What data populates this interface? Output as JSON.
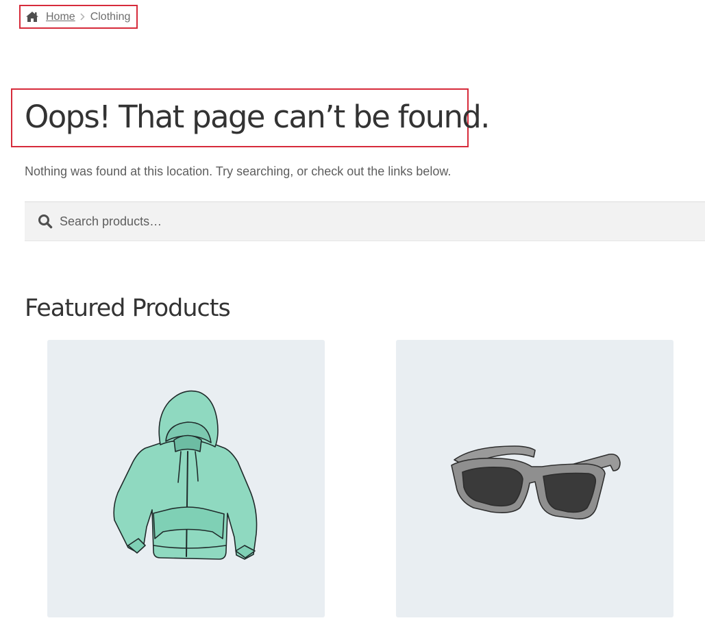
{
  "breadcrumb": {
    "home_label": "Home",
    "current_label": "Clothing"
  },
  "page": {
    "title": "Oops! That page can’t be found.",
    "description": "Nothing was found at this location. Try searching, or check out the links below."
  },
  "search": {
    "placeholder": "Search products…",
    "value": ""
  },
  "featured": {
    "title": "Featured Products",
    "products": [
      {
        "image": "hoodie-illustration"
      },
      {
        "image": "sunglasses-illustration"
      }
    ]
  },
  "colors": {
    "highlight_border": "#d62a3a",
    "search_bg": "#f2f2f2",
    "card_bg": "#e9eef2",
    "hoodie": "#8fd9c0"
  }
}
